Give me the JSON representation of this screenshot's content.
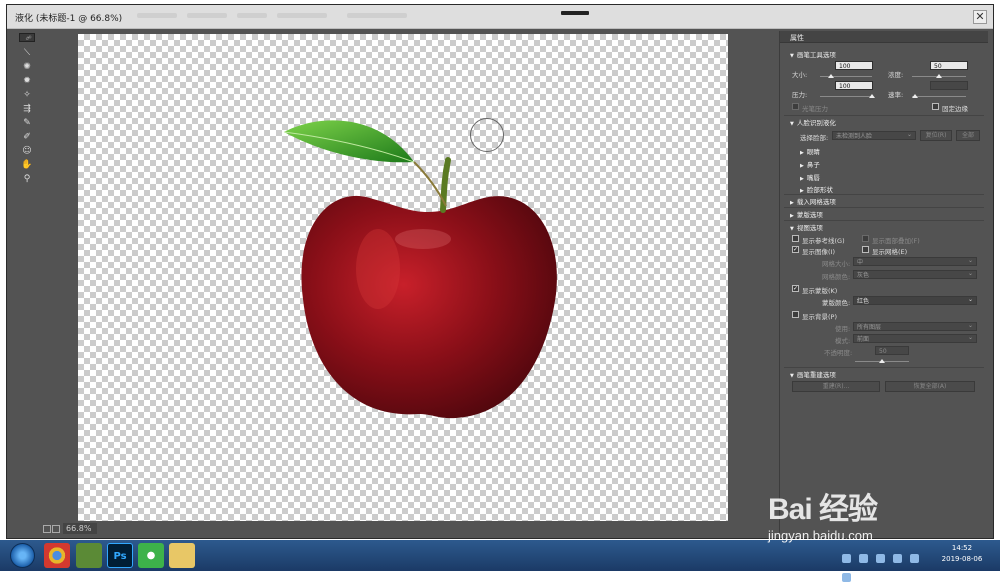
{
  "window": {
    "title": "液化 (未标题-1 @ 66.8%)",
    "close_symbol": "✕"
  },
  "toolbar": {
    "tools": [
      "forward-warp",
      "reconstruct",
      "smooth",
      "twirl",
      "pucker",
      "bloat",
      "push-left",
      "freeze-mask",
      "thaw-mask",
      "face",
      "hand",
      "zoom"
    ]
  },
  "status": {
    "zoom": "66.8%"
  },
  "panel": {
    "title": "属性",
    "brush_options": {
      "heading": "画笔工具选项",
      "size_label": "大小:",
      "size_value": "100",
      "density_label": "浓度:",
      "density_value": "50",
      "pressure_label": "压力:",
      "pressure_value": "100",
      "rate_label": "速率:",
      "stylus_label": "光笔压力",
      "pin_edges_label": "固定边缘"
    },
    "face_aware": {
      "heading": "人脸识别液化",
      "select_face_label": "选择脸部:",
      "select_face_value": "未检测到人脸",
      "reset_button": "复位(R)",
      "all_button": "全部",
      "eyes": "眼睛",
      "nose": "鼻子",
      "mouth": "嘴唇",
      "face_shape": "脸部形状"
    },
    "load_mesh": {
      "heading": "载入网格选项"
    },
    "mask": {
      "heading": "蒙版选项"
    },
    "view": {
      "heading": "视图选项",
      "show_guides": "显示参考线(G)",
      "show_face_overlay": "显示面部叠加(F)",
      "show_image": "显示图像(I)",
      "show_mesh": "显示网格(E)",
      "mesh_size_label": "网格大小:",
      "mesh_size_value": "中",
      "mesh_color_label": "网格颜色:",
      "mesh_color_value": "灰色",
      "show_mask": "显示蒙版(K)",
      "mask_color_label": "蒙版颜色:",
      "mask_color_value": "红色",
      "show_backdrop": "显示背景(P)",
      "use_label": "使用:",
      "use_value": "所有图层",
      "mode_label": "模式:",
      "mode_value": "前面",
      "opacity_label": "不透明度:",
      "opacity_value": "50"
    },
    "brush_reconstruct": {
      "heading": "画笔重建选项",
      "reconstruct_button": "重建(R)...",
      "restore_all_button": "恢复全部(A)"
    }
  },
  "taskbar": {
    "apps": [
      "开始",
      "chrome",
      "minecraft",
      "Ps",
      "360",
      "文件夹"
    ],
    "time": "14:52",
    "date": "2019-08-06"
  },
  "watermark": {
    "logo": "Bai 经验",
    "url": "jingyan.baidu.com"
  },
  "colors": {
    "ui_bg": "#535353",
    "panel_header": "#444444",
    "taskbar": "#1b3a66",
    "ps_blue": "#001e36"
  }
}
